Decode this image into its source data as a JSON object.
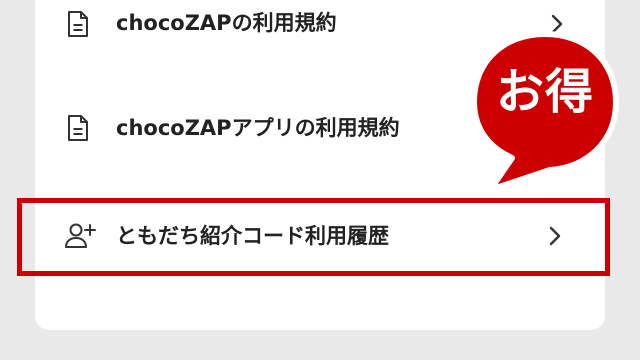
{
  "menu": {
    "items": [
      {
        "label": "chocoZAPの利用規約",
        "icon": "document-icon"
      },
      {
        "label": "chocoZAPアプリの利用規約",
        "icon": "document-icon"
      },
      {
        "label": "ともだち紹介コード利用履歴",
        "icon": "add-user-icon"
      }
    ]
  },
  "badge": {
    "text": "お得",
    "color": "#cc0000"
  },
  "colors": {
    "highlight": "#cc0000",
    "background": "#e9e9ea",
    "card": "#ffffff"
  }
}
